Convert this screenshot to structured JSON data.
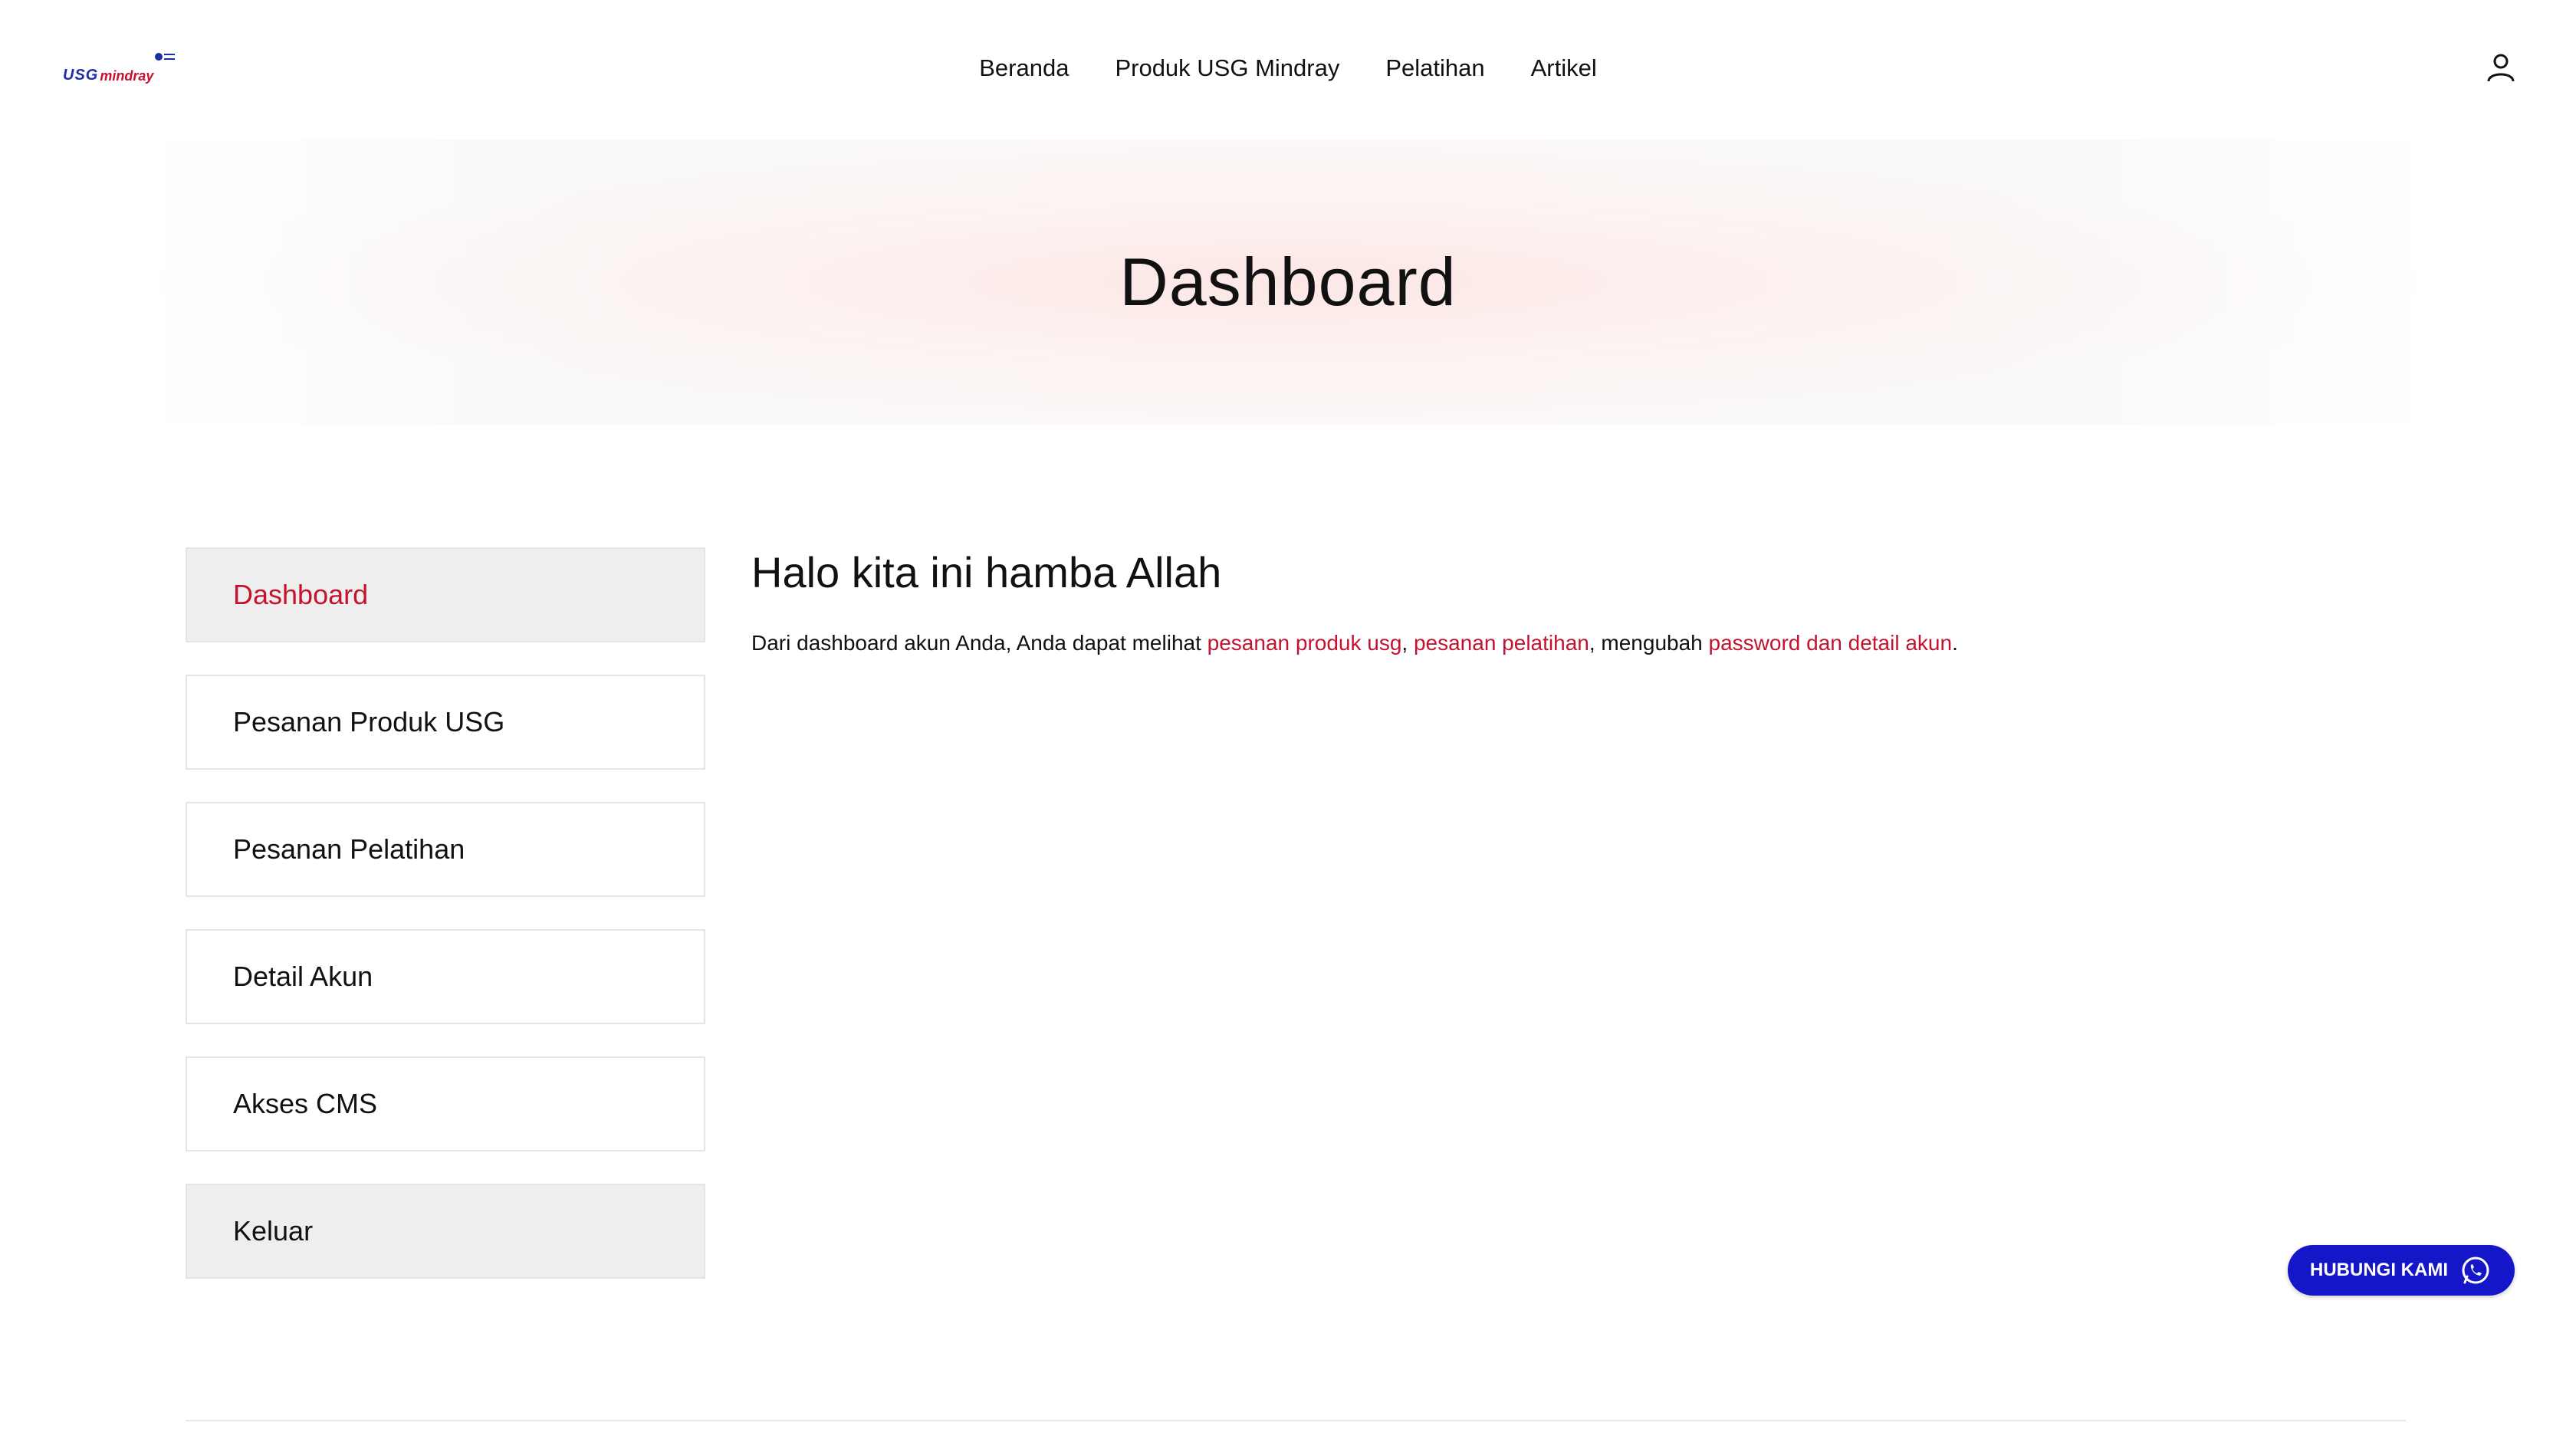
{
  "brand": {
    "logo_primary": "USG",
    "logo_secondary": "mindray",
    "primary_color": "#1a2ea8",
    "accent_color": "#c4122f"
  },
  "nav": {
    "items": [
      {
        "label": "Beranda"
      },
      {
        "label": "Produk USG Mindray"
      },
      {
        "label": "Pelatihan"
      },
      {
        "label": "Artikel"
      }
    ],
    "user_icon": "user-icon"
  },
  "hero": {
    "title": "Dashboard"
  },
  "sidebar": {
    "items": [
      {
        "label": "Dashboard",
        "state": "active"
      },
      {
        "label": "Pesanan Produk USG",
        "state": "default"
      },
      {
        "label": "Pesanan Pelatihan",
        "state": "default"
      },
      {
        "label": "Detail Akun",
        "state": "default"
      },
      {
        "label": "Akses CMS",
        "state": "default"
      },
      {
        "label": "Keluar",
        "state": "muted"
      }
    ]
  },
  "content": {
    "greeting": "Halo kita ini hamba Allah",
    "intro_prefix": "Dari dashboard akun Anda, Anda dapat melihat ",
    "link_orders": "pesanan produk usg",
    "sep1": ", ",
    "link_training": "pesanan pelatihan",
    "sep2": ", mengubah ",
    "link_account": "password dan detail akun",
    "suffix": "."
  },
  "whatsapp": {
    "label": "HUBUNGI KAMI",
    "icon": "whatsapp-icon",
    "color": "#1616c9"
  }
}
